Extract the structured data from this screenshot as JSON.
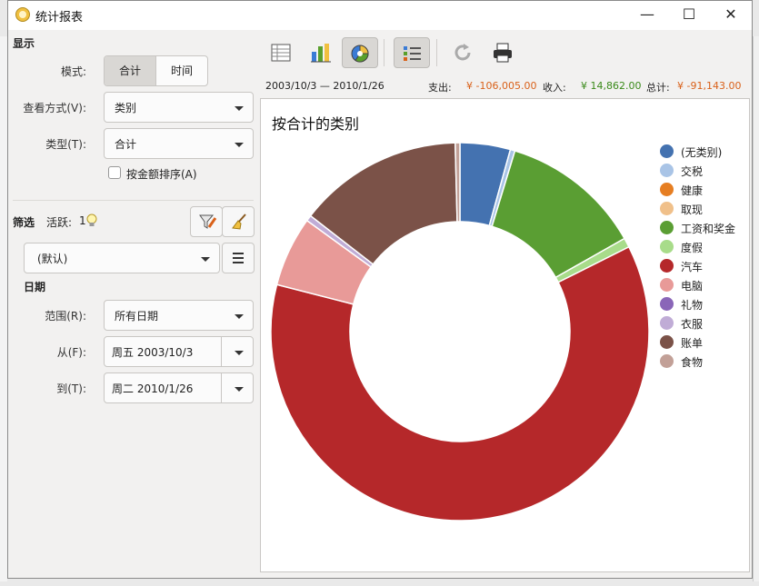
{
  "window": {
    "title": "统计报表"
  },
  "sidebar": {
    "display_section": "显示",
    "mode_label": "模式:",
    "mode_options": [
      "合计",
      "时间"
    ],
    "view_label": "查看方式(V):",
    "view_value": "类别",
    "type_label": "类型(T):",
    "type_value": "合计",
    "sort_checkbox_label": "按金额排序(A)",
    "filter_section": "筛选",
    "active_label": "活跃:",
    "active_count": "1",
    "filter_value": "(默认)",
    "date_section": "日期",
    "range_label": "范围(R):",
    "range_value": "所有日期",
    "from_label": "从(F):",
    "from_value": "周五 2003/10/3",
    "to_label": "到(T):",
    "to_value": "周二 2010/1/26"
  },
  "summary": {
    "date_range": "2003/10/3 — 2010/1/26",
    "expense_label": "支出:",
    "expense_value": "¥ -106,005.00",
    "income_label": "收入:",
    "income_value": "¥ 14,862.00",
    "total_label": "总计:",
    "total_value": "¥ -91,143.00"
  },
  "colors": {
    "expense": "#d9611a",
    "income": "#3a8a1a",
    "total": "#d9611a"
  },
  "toolbar_icons": [
    "table-view-icon",
    "bar-chart-icon",
    "pie-chart-icon",
    "legend-list-icon",
    "refresh-icon",
    "print-icon"
  ],
  "chart_data": {
    "type": "pie",
    "title": "按合计的类别",
    "donut": true,
    "legend_position": "right",
    "categories": [
      "(无类别)",
      "交税",
      "健康",
      "取现",
      "工资和奖金",
      "度假",
      "汽车",
      "电脑",
      "礼物",
      "衣服",
      "账单",
      "食物"
    ],
    "values": [
      4.3,
      0.4,
      0,
      0,
      12.1,
      0.8,
      61.4,
      6.0,
      0,
      0.5,
      14.1,
      0.4
    ],
    "colors": [
      "#4472b0",
      "#a9c4e6",
      "#e67e22",
      "#f0c08a",
      "#5a9e33",
      "#a8dc8a",
      "#b5282a",
      "#e89a98",
      "#8a66b8",
      "#c0acd6",
      "#7b5248",
      "#c2a097"
    ]
  }
}
